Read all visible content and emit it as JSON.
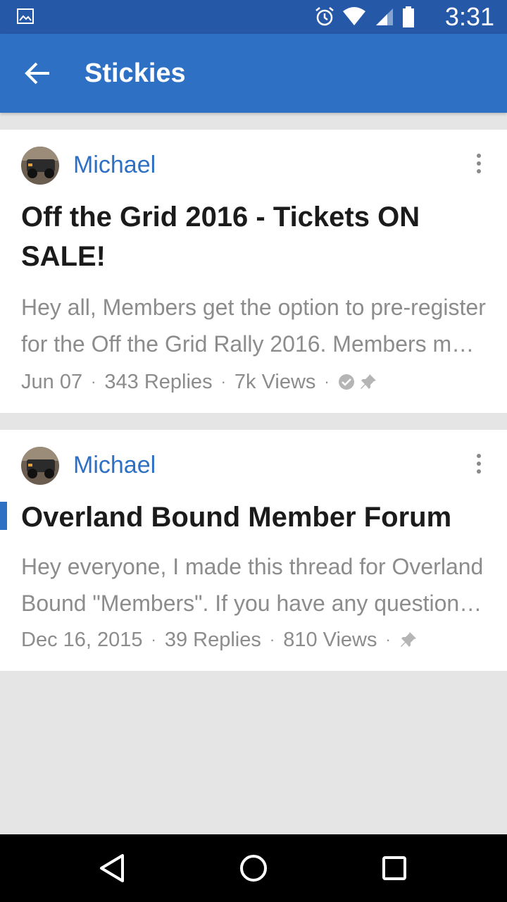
{
  "status_bar": {
    "time": "3:31",
    "icons": [
      "gallery-icon",
      "alarm-icon",
      "wifi-icon",
      "cell-signal-icon",
      "battery-icon"
    ]
  },
  "app_bar": {
    "title": "Stickies",
    "back_icon": "arrow-left-icon"
  },
  "threads": [
    {
      "author": "Michael",
      "title": "Off the Grid 2016 - Tickets ON SALE!",
      "snippet": "Hey all, Members get the option to pre-register for the Off the Grid Rally 2016. Members must log in to see the rest of this post and the tickets link below",
      "date": "Jun 07",
      "replies": "343 Replies",
      "views": "7k Views",
      "answered": true,
      "pinned": true,
      "unread": false
    },
    {
      "author": "Michael",
      "title": "Overland Bound Member Forum",
      "snippet": "Hey everyone, I made this thread for Overland Bound \"Members\". If you have any questions please post them here",
      "date": "Dec 16, 2015",
      "replies": "39 Replies",
      "views": "810 Views",
      "answered": false,
      "pinned": true,
      "unread": true
    }
  ],
  "colors": {
    "status_bar": "#2559a8",
    "app_bar": "#2e70c4",
    "accent": "#2e70c4",
    "title_text": "#1b1b1b",
    "secondary_text": "#8c8c8c",
    "background": "#e5e5e5",
    "card": "#ffffff"
  },
  "nav_bar": {
    "icons": [
      "back-triangle-icon",
      "home-circle-icon",
      "recents-square-icon"
    ]
  }
}
